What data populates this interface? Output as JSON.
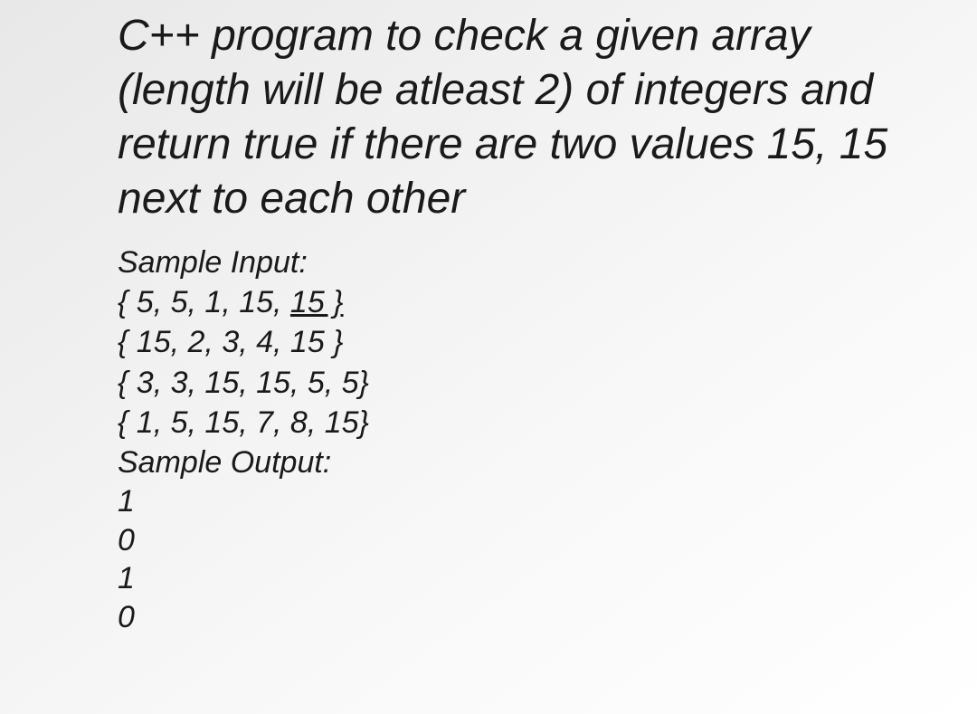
{
  "title": "C++ program to check a given array (length will be atleast 2) of integers and return true if there are two values 15, 15 next to each other",
  "sample_input_label": "Sample Input:",
  "inputs": [
    {
      "prefix": "{ 5, 5, 1, 15, ",
      "underlined": "15 }",
      "suffix": ""
    },
    {
      "prefix": "{ 15, 2, 3, 4, 15 }",
      "underlined": "",
      "suffix": ""
    },
    {
      "prefix": "{ 3, 3, 15, 15, 5, 5}",
      "underlined": "",
      "suffix": ""
    },
    {
      "prefix": "{ 1, 5, 15, 7, 8, 15}",
      "underlined": "",
      "suffix": ""
    }
  ],
  "sample_output_label": "Sample Output:",
  "outputs": [
    "1",
    "0",
    "1",
    "0"
  ]
}
